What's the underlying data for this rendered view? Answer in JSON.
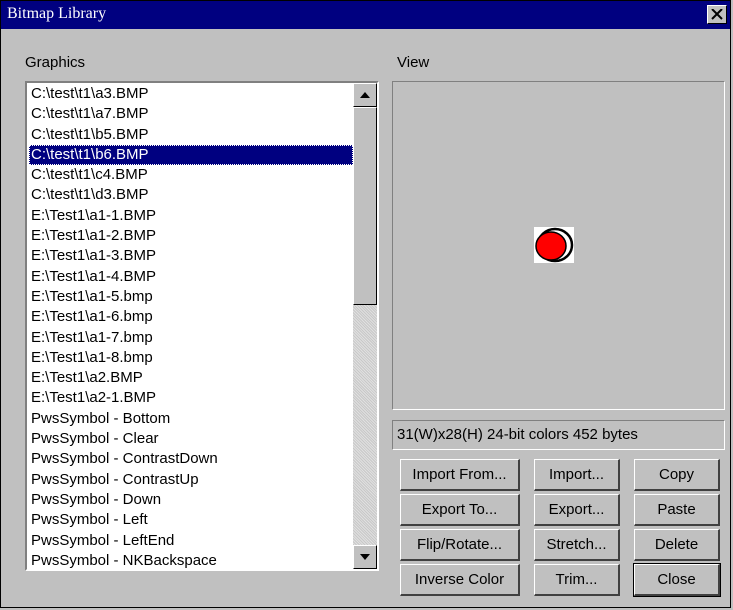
{
  "window": {
    "title": "Bitmap Library",
    "close_glyph": "✕"
  },
  "graphics": {
    "label": "Graphics",
    "items": [
      "C:\\test\\t1\\a3.BMP",
      "C:\\test\\t1\\a7.BMP",
      "C:\\test\\t1\\b5.BMP",
      "C:\\test\\t1\\b6.BMP",
      "C:\\test\\t1\\c4.BMP",
      "C:\\test\\t1\\d3.BMP",
      "E:\\Test1\\a1-1.BMP",
      "E:\\Test1\\a1-2.BMP",
      "E:\\Test1\\a1-3.BMP",
      "E:\\Test1\\a1-4.BMP",
      "E:\\Test1\\a1-5.bmp",
      "E:\\Test1\\a1-6.bmp",
      "E:\\Test1\\a1-7.bmp",
      "E:\\Test1\\a1-8.bmp",
      "E:\\Test1\\a2.BMP",
      "E:\\Test1\\a2-1.BMP",
      "PwsSymbol - Bottom",
      "PwsSymbol - Clear",
      "PwsSymbol - ContrastDown",
      "PwsSymbol - ContrastUp",
      "PwsSymbol - Down",
      "PwsSymbol - Left",
      "PwsSymbol - LeftEnd",
      "PwsSymbol - NKBackspace"
    ],
    "selected": "C:\\test\\t1\\b6.BMP"
  },
  "view": {
    "label": "View",
    "preview_icon": "red-circle-icon",
    "preview_color": "#ff0000",
    "info": "31(W)x28(H)   24-bit colors   452 bytes"
  },
  "buttons": {
    "import_from": "Import From...",
    "import": "Import...",
    "copy": "Copy",
    "export_to": "Export To...",
    "export": "Export...",
    "paste": "Paste",
    "flip_rotate": "Flip/Rotate...",
    "stretch": "Stretch...",
    "delete": "Delete",
    "inverse_color": "Inverse Color",
    "trim": "Trim...",
    "close": "Close"
  }
}
